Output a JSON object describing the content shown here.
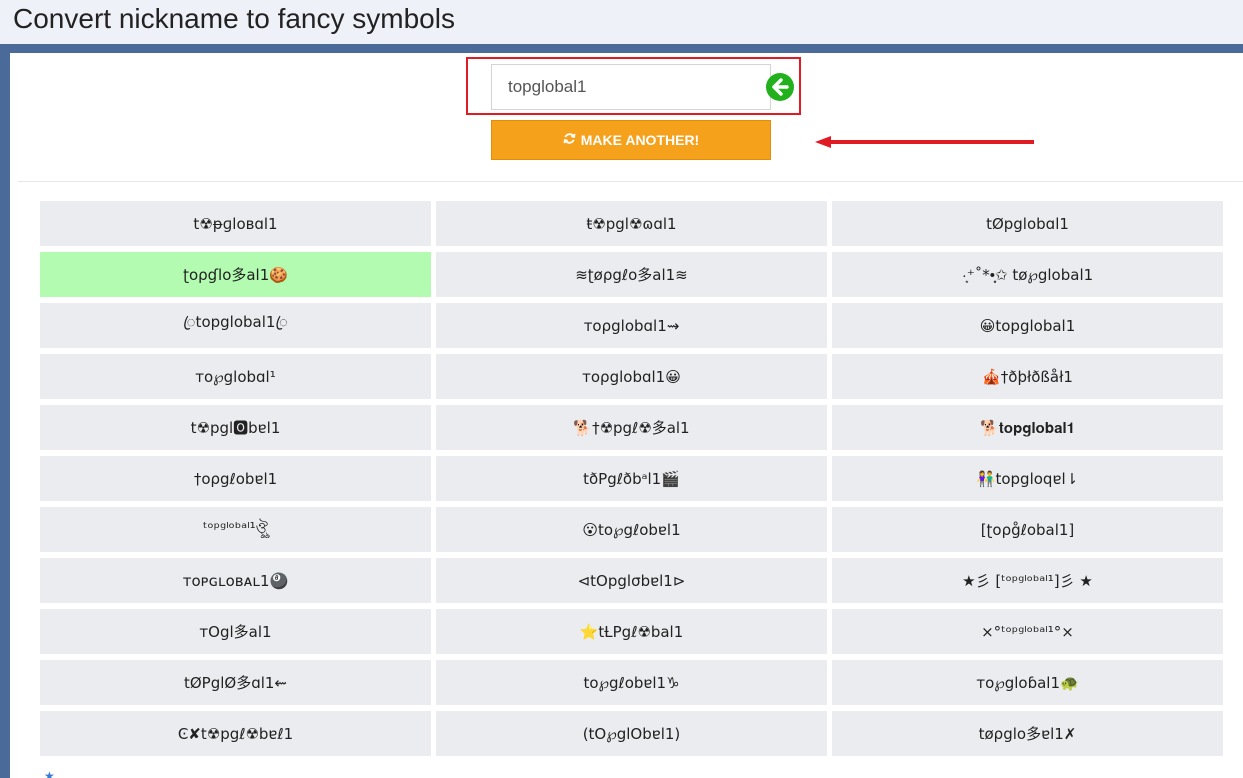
{
  "page": {
    "title": "Convert nickname to fancy symbols"
  },
  "input": {
    "value": "topglobal1"
  },
  "make_button": {
    "label": "MAKE ANOTHER!"
  },
  "colors": {
    "header_bg": "#eef1f7",
    "frame_border": "#4a6a9a",
    "highlight_box": "#e01b24",
    "button_bg": "#f5a11c",
    "go_icon": "#22b11c",
    "cell_bg": "#eaecef",
    "selected_cell_bg": "#b2fbb0",
    "arrow": "#e01b24"
  },
  "icons": {
    "go": "arrow-left-circle-icon",
    "refresh": "refresh-icon",
    "pointer": "red-arrow-left-icon"
  },
  "variants": [
    "t☢ᵽɡlᴏʙɑl1",
    "ŧ☢pgl☢ɷɑl1",
    "tØpglobɑl1",
    "ʈօρɠlօ多al1🍪",
    "≋ʈøρgℓo多al1≋",
    "·͙⁺˚*•̩̩͙✩ tø℘global1",
    "ꦿtopglobal1ꦿ",
    "ᴛoρglobɑl1⇝",
    "😀topglobal1",
    "ᴛo℘globɑl¹",
    "ᴛoρglobɑl1😀",
    "🎪†ðþłðßåł1",
    "t☢pgl🅾bɐl1",
    "🐕†☢pgℓ☢多al1",
    "🐕𝐭𝐨𝐩𝐠𝐥𝐨𝐛𝐚𝐥𝟏",
    "†oρgℓobɐl1",
    "tðPgℓðbᵃl1🎬",
    "👫topgloqɐl⇂",
    "ᵗᵒᵖᵍˡᵒᵇᵃˡ¹ঔৣ",
    "😮to℘gℓobɐl1",
    "[ʈօρg̊ℓobal1]",
    "ᴛᴏᴘɢʟᴏʙᴀʟ1🎱",
    "⊲tOpglσbɐl1⊳",
    "★彡 [ᵗᵒᵖᵍˡᵒᵇᵃˡ¹]彡 ★",
    "ᴛOgl多al1",
    "⭐tȽPgℓ☢bal1",
    "×°ᵗᵒᵖᵍˡᵒᵇᵃˡ¹°×",
    "tØPglØ多ɑl1⇜",
    "to℘gℓobɐl1♑",
    "ᴛo℘gloɓal1🐢",
    "Ͼ✘t☢pgℓ☢bɐℓ1",
    "(tO℘glObɐl1)",
    "tøρglo多ɐl1✗"
  ],
  "selected_index": 3,
  "footer": {
    "text": "★"
  }
}
